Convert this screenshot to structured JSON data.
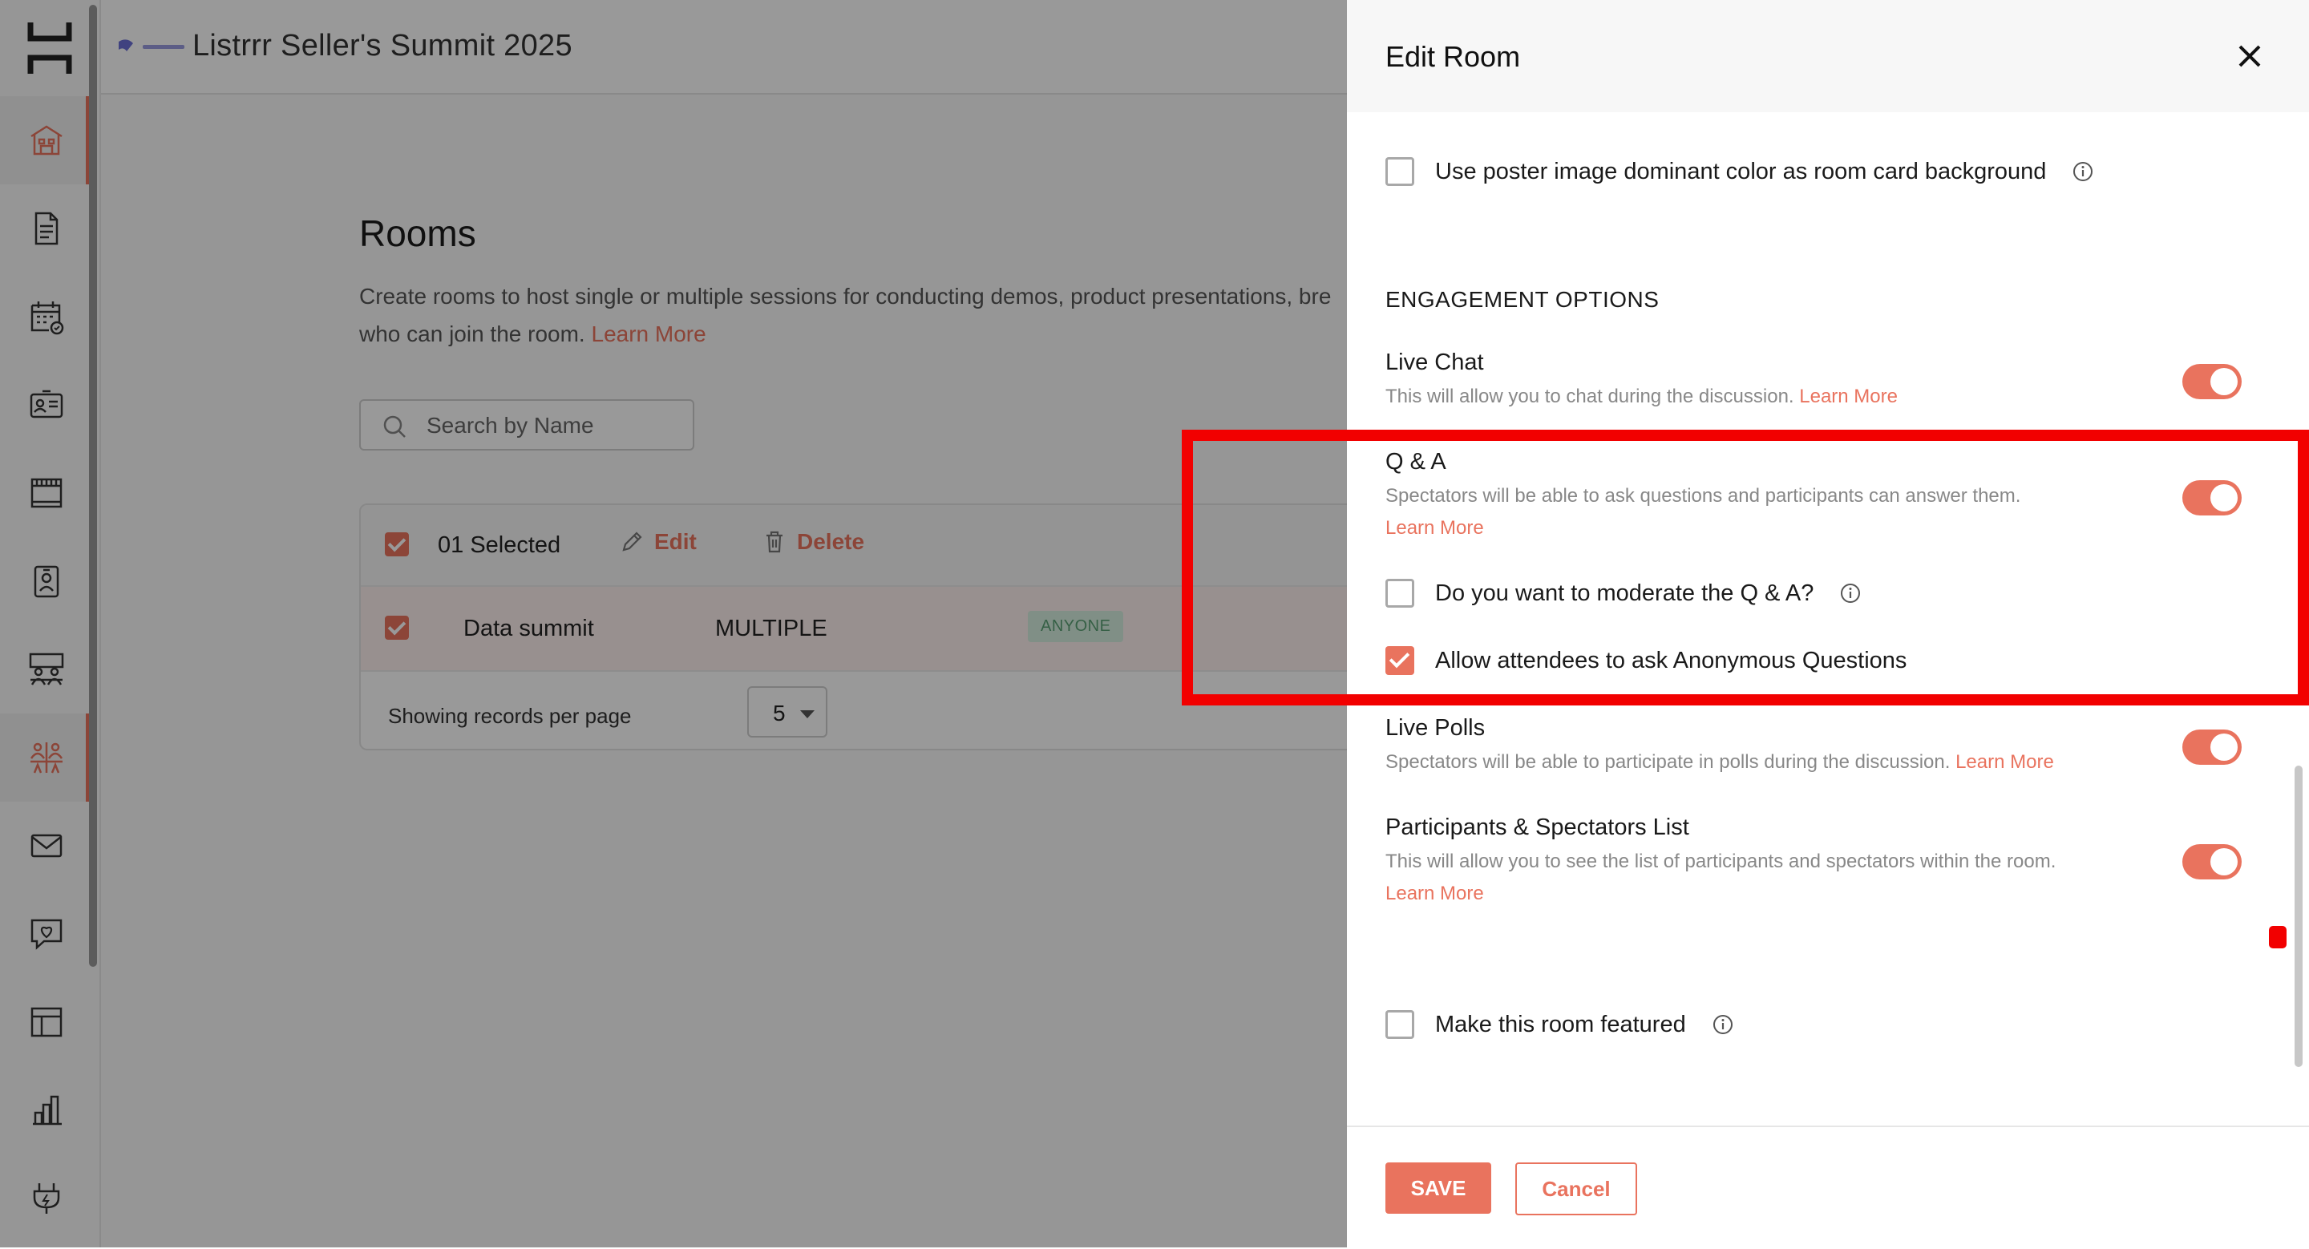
{
  "app": {
    "event_title": "Listrrr Seller's Summit 2025"
  },
  "sidebar": {
    "items": [
      {
        "icon": "venue-icon"
      },
      {
        "icon": "document-icon"
      },
      {
        "icon": "calendar-icon"
      },
      {
        "icon": "id-card-icon"
      },
      {
        "icon": "booth-icon"
      },
      {
        "icon": "badge-icon"
      },
      {
        "icon": "networking-icon"
      },
      {
        "icon": "rooms-icon"
      },
      {
        "icon": "mail-icon"
      },
      {
        "icon": "feedback-icon"
      },
      {
        "icon": "layout-icon"
      },
      {
        "icon": "analytics-icon"
      },
      {
        "icon": "integrations-icon"
      }
    ]
  },
  "rooms_page": {
    "title": "Rooms",
    "description": "Create rooms to host single or multiple sessions for conducting demos, product presentations, bre",
    "description_line2": "who can join the room.",
    "learn_more": "Learn More",
    "search_placeholder": "Search by Name",
    "toolbar": {
      "selected": "01 Selected",
      "edit": "Edit",
      "delete": "Delete"
    },
    "rows": [
      {
        "name": "Data summit",
        "type": "MULTIPLE",
        "access": "ANYONE",
        "checked": true
      }
    ],
    "pager": {
      "label": "Showing records per page",
      "value": "5"
    }
  },
  "drawer": {
    "title": "Edit Room",
    "poster_option": "Use poster image dominant color as room card background",
    "engagement_heading": "ENGAGEMENT OPTIONS",
    "live_chat": {
      "title": "Live Chat",
      "desc": "This will allow you to chat during the discussion.",
      "link": "Learn More",
      "enabled": true
    },
    "qa": {
      "title": "Q & A",
      "desc": "Spectators will be able to ask questions and participants can answer them.",
      "link": "Learn More",
      "enabled": true,
      "moderate_label": "Do you want to moderate the Q & A?",
      "moderate_checked": false,
      "anonymous_label": "Allow attendees to ask Anonymous Questions",
      "anonymous_checked": true
    },
    "live_polls": {
      "title": "Live Polls",
      "desc": "Spectators will be able to participate in polls during the discussion.",
      "link": "Learn More",
      "enabled": true
    },
    "participants_list": {
      "title": "Participants & Spectators List",
      "desc": "This will allow you to see the list of participants and spectators within the room.",
      "link": "Learn More",
      "enabled": true
    },
    "featured_label": "Make this room featured",
    "save": "SAVE",
    "cancel": "Cancel"
  },
  "colors": {
    "accent": "#e9735e",
    "highlight": "#f20000",
    "badge_bg": "#d6efdf",
    "badge_text": "#5aa175"
  }
}
